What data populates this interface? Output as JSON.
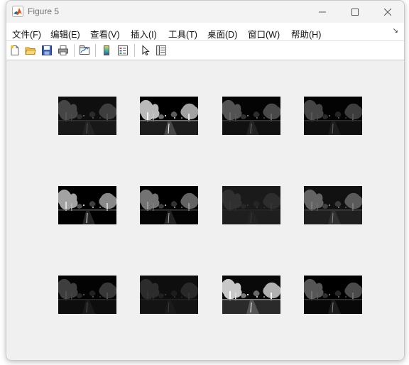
{
  "window": {
    "title": "Figure 5"
  },
  "menu": {
    "items": [
      {
        "label": "文件(F)"
      },
      {
        "label": "编辑(E)"
      },
      {
        "label": "查看(V)"
      },
      {
        "label": "插入(I)"
      },
      {
        "label": "工具(T)"
      },
      {
        "label": "桌面(D)"
      },
      {
        "label": "窗口(W)"
      },
      {
        "label": "帮助(H)"
      }
    ]
  },
  "toolbar": {
    "buttons": [
      {
        "icon": "new-figure-icon"
      },
      {
        "icon": "open-folder-icon"
      },
      {
        "icon": "save-icon"
      },
      {
        "icon": "print-icon"
      },
      {
        "icon": "link-plot-icon"
      },
      {
        "icon": "colorbar-icon"
      },
      {
        "icon": "legend-icon"
      },
      {
        "icon": "pointer-icon"
      },
      {
        "icon": "property-inspector-icon"
      }
    ]
  },
  "figure": {
    "images": [
      {
        "brightness": 0.45,
        "contrast": 0.9
      },
      {
        "brightness": 1.3,
        "contrast": 1.1
      },
      {
        "brightness": 0.6,
        "contrast": 1.0
      },
      {
        "brightness": 0.5,
        "contrast": 1.0
      },
      {
        "brightness": 1.1,
        "contrast": 1.4
      },
      {
        "brightness": 0.85,
        "contrast": 1.2
      },
      {
        "brightness": 0.2,
        "contrast": 0.8
      },
      {
        "brightness": 0.7,
        "contrast": 0.9
      },
      {
        "brightness": 0.45,
        "contrast": 1.0
      },
      {
        "brightness": 0.25,
        "contrast": 0.9
      },
      {
        "brightness": 1.45,
        "contrast": 1.0
      },
      {
        "brightness": 0.65,
        "contrast": 1.1
      }
    ]
  }
}
